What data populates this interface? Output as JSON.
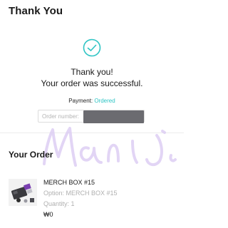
{
  "header": {
    "title": "Thank You"
  },
  "confirmation": {
    "icon": "check-circle-icon",
    "accent_color": "#2ec4c4",
    "line1": "Thank you!",
    "line2": "Your order was successful.",
    "payment_label": "Payment:",
    "payment_status": "Ordered",
    "order_number_label": "Order number:"
  },
  "order": {
    "section_title": "Your Order",
    "item": {
      "name": "MERCH BOX #15",
      "option": "Option: MERCH BOX #15",
      "quantity": "Quantity: 1",
      "price": "₩0"
    }
  }
}
